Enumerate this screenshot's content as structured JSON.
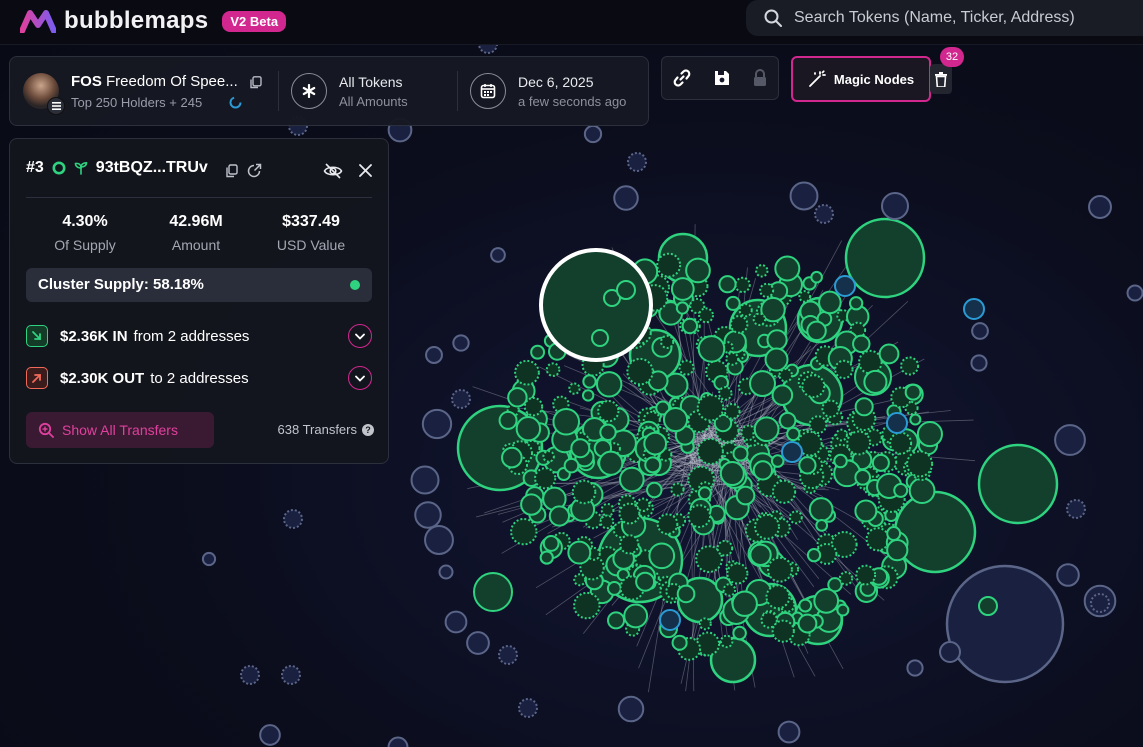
{
  "app": {
    "name": "bubblemaps",
    "badge": "V2 Beta"
  },
  "search": {
    "placeholder": "Search Tokens (Name, Ticker, Address)"
  },
  "token": {
    "ticker": "FOS",
    "name": "Freedom Of Spee...",
    "holders": "Top 250 Holders + 245"
  },
  "filter": {
    "title": "All Tokens",
    "sub": "All Amounts"
  },
  "date": {
    "title": "Dec 6, 2025",
    "sub": "a few seconds ago"
  },
  "magic": {
    "label": "Magic Nodes",
    "count": "32"
  },
  "panel": {
    "rank": "#3",
    "address": "93tBQZ...TRUv",
    "stats": [
      {
        "value": "4.30%",
        "label": "Of Supply"
      },
      {
        "value": "42.96M",
        "label": "Amount"
      },
      {
        "value": "$337.49",
        "label": "USD Value"
      }
    ],
    "cluster": "Cluster Supply: 58.18%",
    "in_amount": "$2.36K IN",
    "in_text": "from 2 addresses",
    "out_amount": "$2.30K OUT",
    "out_text": "to 2 addresses",
    "show_all": "Show All Transfers",
    "transfers": "638 Transfers"
  },
  "colors": {
    "accent": "#d2278f",
    "green": "#2fd37f",
    "cluster_fill": "#13402d",
    "blue": "#2a9bd4",
    "node_blue": "#5a6588"
  }
}
